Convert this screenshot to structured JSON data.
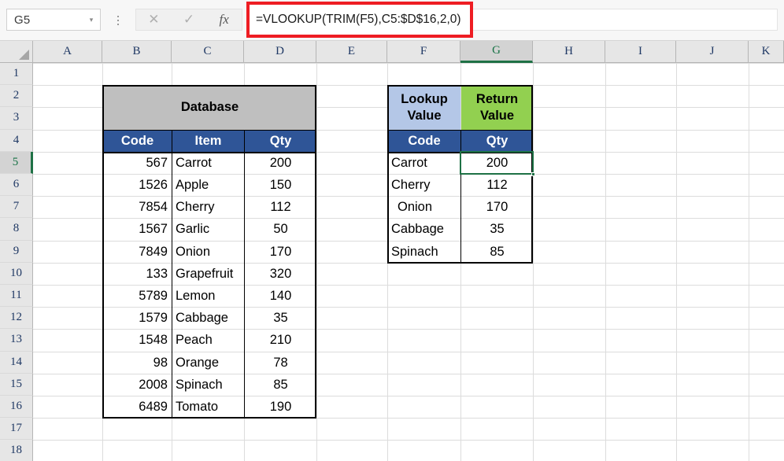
{
  "app": {
    "name_box": {
      "value": "G5",
      "placeholder": "Name Box",
      "caret": "▾"
    },
    "formula_bar": {
      "cancel_icon": "✕",
      "enter_icon": "✓",
      "insert_function_icon": "fx",
      "value": "=VLOOKUP(TRIM(F5),C5:$D$16,2,0)",
      "placeholder": "",
      "annotation_color": "#ee1d23"
    }
  },
  "grid": {
    "columns": [
      "A",
      "B",
      "C",
      "D",
      "E",
      "F",
      "G",
      "H",
      "I",
      "J",
      "K"
    ],
    "rows": [
      "1",
      "2",
      "3",
      "4",
      "5",
      "6",
      "7",
      "8",
      "9",
      "10",
      "11",
      "12",
      "13",
      "14",
      "15",
      "16",
      "17",
      "18"
    ],
    "selected_column": "G",
    "selected_row": "5",
    "active_cell": "G5"
  },
  "colors": {
    "header_blue": "#2f5597",
    "merged_gray": "#bfbfbf",
    "lookup_light_blue": "#b4c7e7",
    "return_green": "#92d050",
    "selection_green": "#1e7145",
    "annotation_red": "#ee1d23",
    "header_text_blue": "#1f3864"
  },
  "database_table": {
    "title": "Database",
    "headers": [
      "Code",
      "Item",
      "Qty"
    ],
    "rows": [
      {
        "row": "5",
        "code": "567",
        "item": "Carrot",
        "qty": "200"
      },
      {
        "row": "6",
        "code": "1526",
        "item": "Apple",
        "qty": "150"
      },
      {
        "row": "7",
        "code": "7854",
        "item": "Cherry",
        "qty": "112"
      },
      {
        "row": "8",
        "code": "1567",
        "item": "Garlic",
        "qty": "50"
      },
      {
        "row": "9",
        "code": "7849",
        "item": "Onion",
        "qty": "170"
      },
      {
        "row": "10",
        "code": "133",
        "item": "Grapefruit",
        "qty": "320"
      },
      {
        "row": "11",
        "code": "5789",
        "item": "Lemon",
        "qty": "140"
      },
      {
        "row": "12",
        "code": "1579",
        "item": "Cabbage",
        "qty": "35"
      },
      {
        "row": "13",
        "code": "1548",
        "item": "Peach",
        "qty": "210"
      },
      {
        "row": "14",
        "code": "98",
        "item": "Orange",
        "qty": "78"
      },
      {
        "row": "15",
        "code": "2008",
        "item": "Spinach",
        "qty": "85"
      },
      {
        "row": "16",
        "code": "6489",
        "item": "Tomato",
        "qty": "190"
      }
    ]
  },
  "lookup_table": {
    "lookup_value_label_line1": "Lookup",
    "lookup_value_label_line2": "Value",
    "return_value_label_line1": "Return",
    "return_value_label_line2": "Value",
    "headers": [
      "Code",
      "Qty"
    ],
    "rows": [
      {
        "row": "5",
        "code": "Carrot",
        "qty": "200",
        "indented": false
      },
      {
        "row": "6",
        "code": "Cherry",
        "qty": "112",
        "indented": false
      },
      {
        "row": "7",
        "code": "Onion",
        "qty": "170",
        "indented": true
      },
      {
        "row": "8",
        "code": "Cabbage",
        "qty": "35",
        "indented": false
      },
      {
        "row": "9",
        "code": "Spinach",
        "qty": "85",
        "indented": false
      }
    ]
  }
}
